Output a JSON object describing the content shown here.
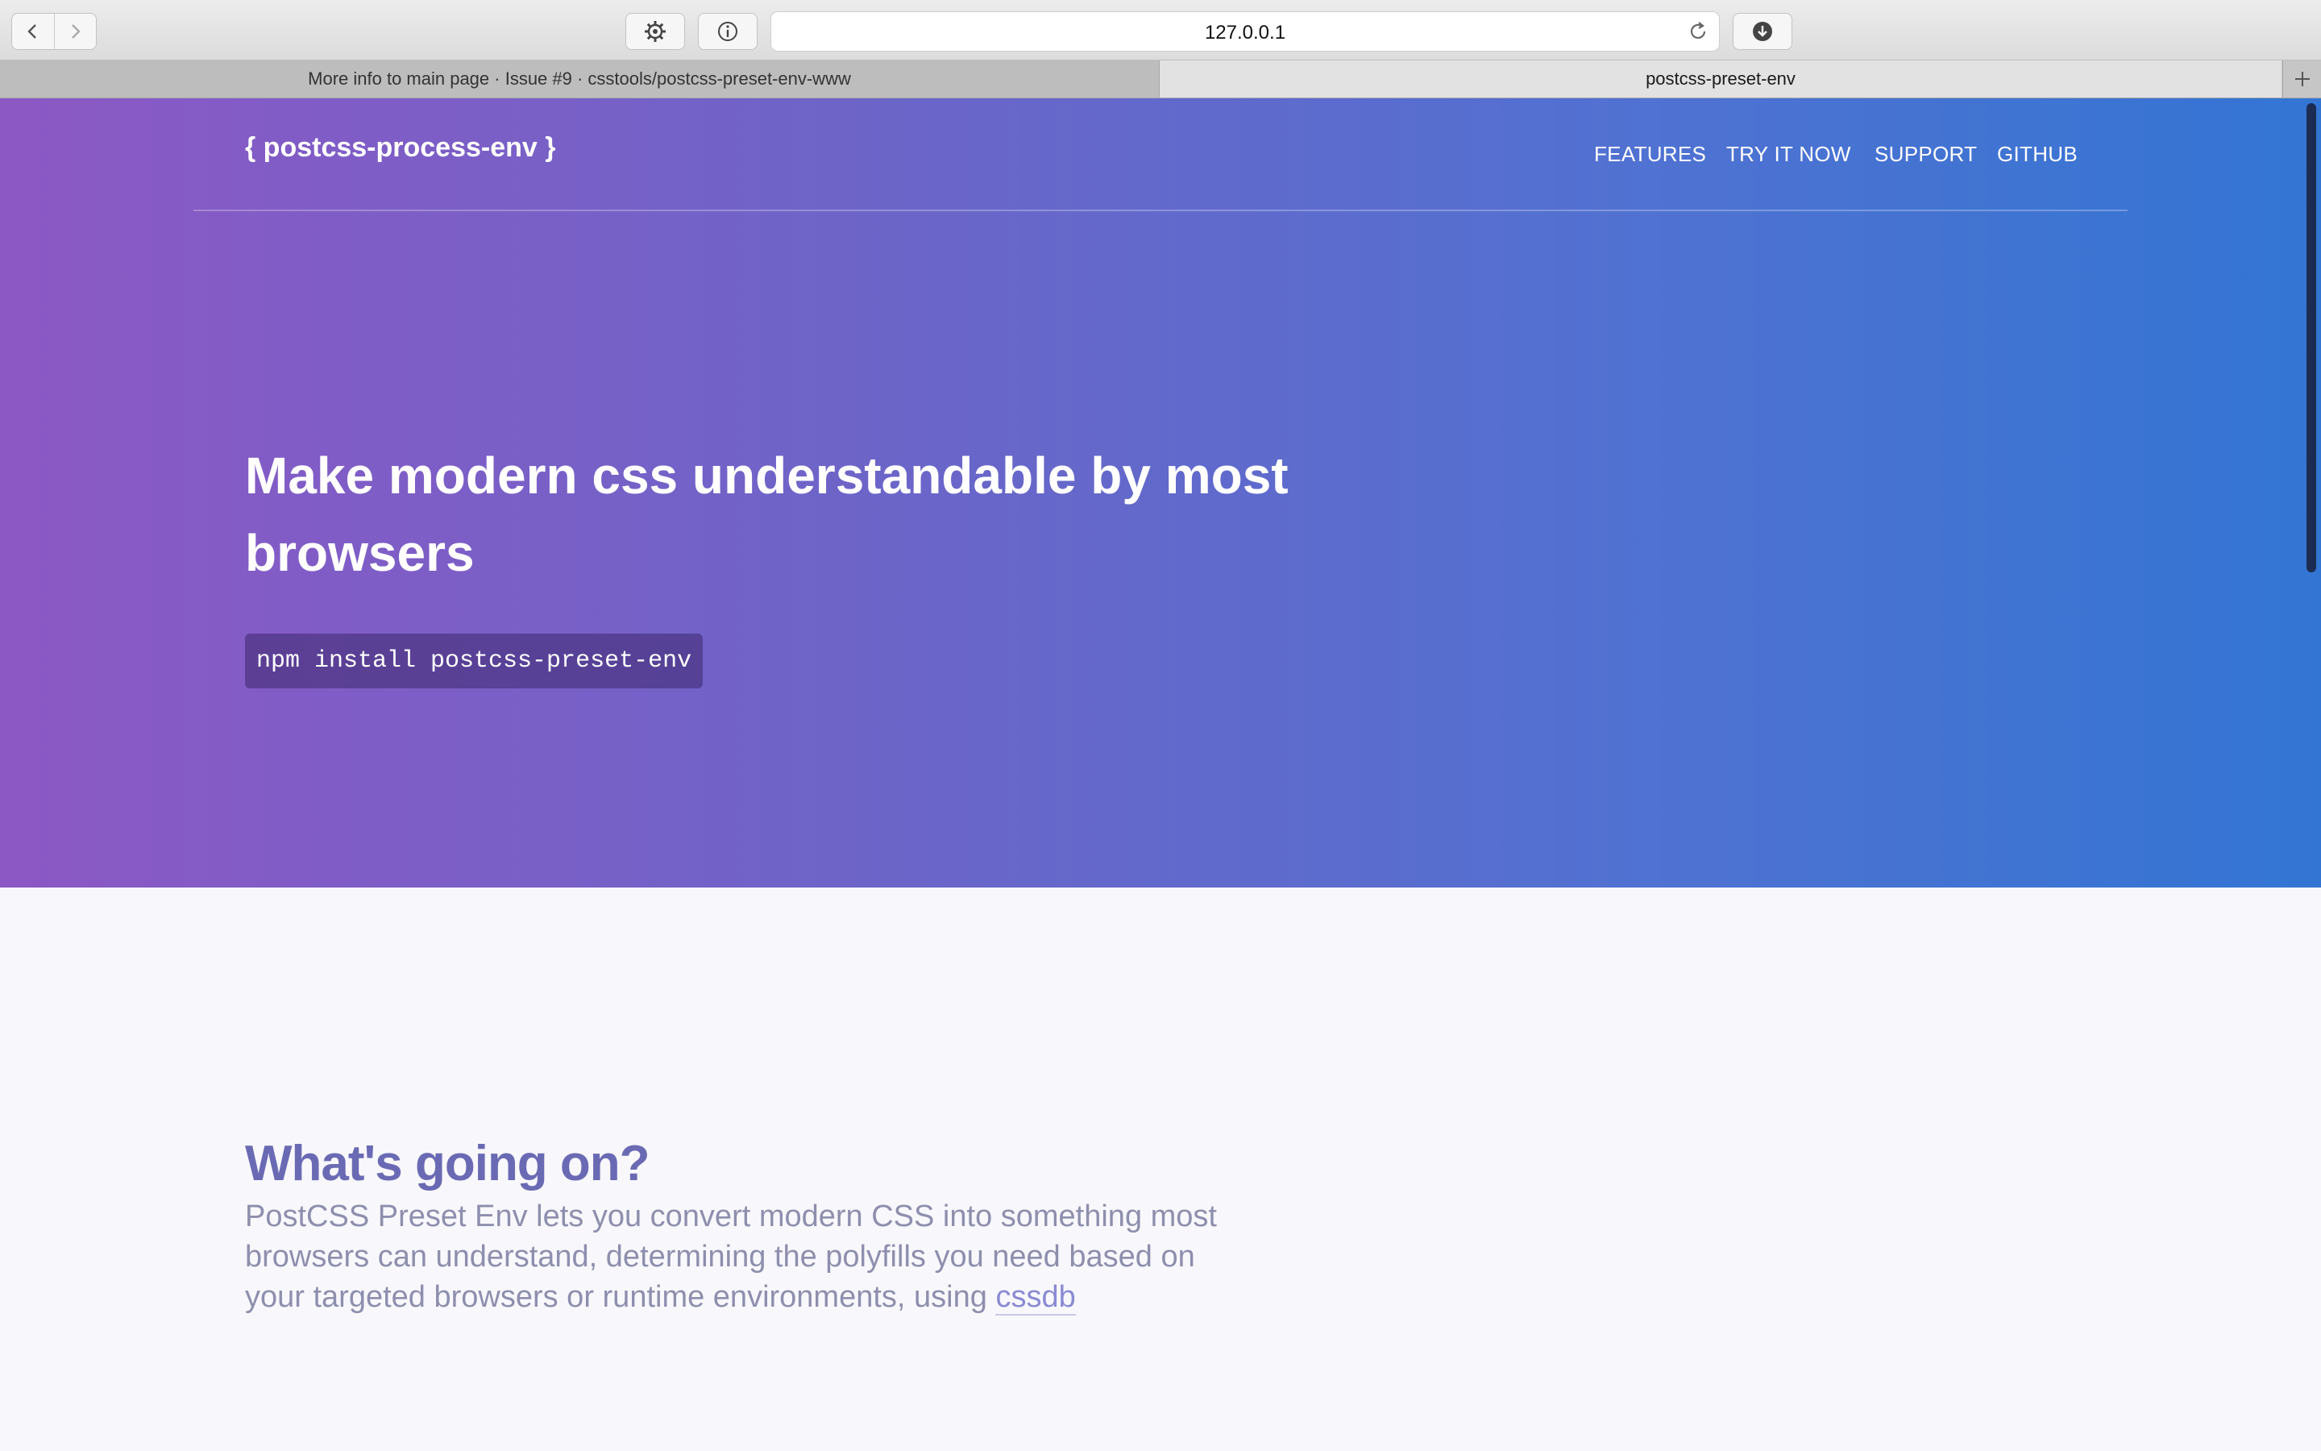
{
  "browser": {
    "url": "127.0.0.1",
    "tabs": [
      {
        "label": "More info to main page · Issue #9 · csstools/postcss-preset-env-www"
      },
      {
        "label": "postcss-preset-env"
      }
    ]
  },
  "header": {
    "brand": "{ postcss-process-env }",
    "nav": [
      "FEATURES",
      "TRY IT NOW",
      "SUPPORT",
      "GITHUB"
    ]
  },
  "hero": {
    "headline": "Make modern css understandable by most browsers",
    "install_command": "npm install postcss-preset-env"
  },
  "section": {
    "title": "What's going on?",
    "body": "PostCSS Preset Env lets you convert modern CSS into something most browsers can understand, determining the polyfills you need based on your targeted browsers or runtime environments, using ",
    "link": "cssdb"
  },
  "colors": {
    "gradient_start": "#8c58c4",
    "gradient_end": "#3375d3",
    "section_title": "#6a6ab4",
    "body_text": "#8e8eae"
  }
}
